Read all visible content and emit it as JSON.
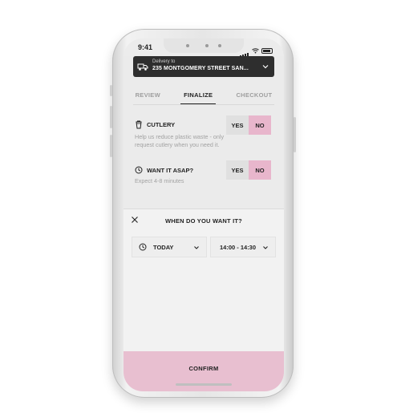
{
  "status_bar": {
    "time": "9:41"
  },
  "delivery": {
    "label": "Delivery to",
    "address": "235 MONTGOMERY STREET SAN..."
  },
  "tabs": [
    {
      "label": "REVIEW"
    },
    {
      "label": "FINALIZE"
    },
    {
      "label": "CHECKOUT"
    }
  ],
  "active_tab": "FINALIZE",
  "cutlery": {
    "title": "CUTLERY",
    "help": "Help us reduce plastic waste - only request cutlery when you need it.",
    "yes_label": "YES",
    "no_label": "NO",
    "selected": "NO"
  },
  "asap": {
    "title": "WANT IT ASAP?",
    "help": "Expect 4-8 minutes",
    "yes_label": "YES",
    "no_label": "NO",
    "selected": "NO"
  },
  "sheet": {
    "title": "WHEN DO YOU WANT IT?",
    "day_select": "TODAY",
    "time_select": "14:00 - 14:30"
  },
  "confirm_label": "CONFIRM",
  "colors": {
    "accent_pink": "#e8b6cc",
    "dark_bar": "#2e2e2e"
  },
  "icons": {
    "cutlery": "cup-icon",
    "asap": "clock-icon",
    "close": "close-icon",
    "chevron": "chevron-down-icon",
    "delivery": "truck-icon"
  }
}
